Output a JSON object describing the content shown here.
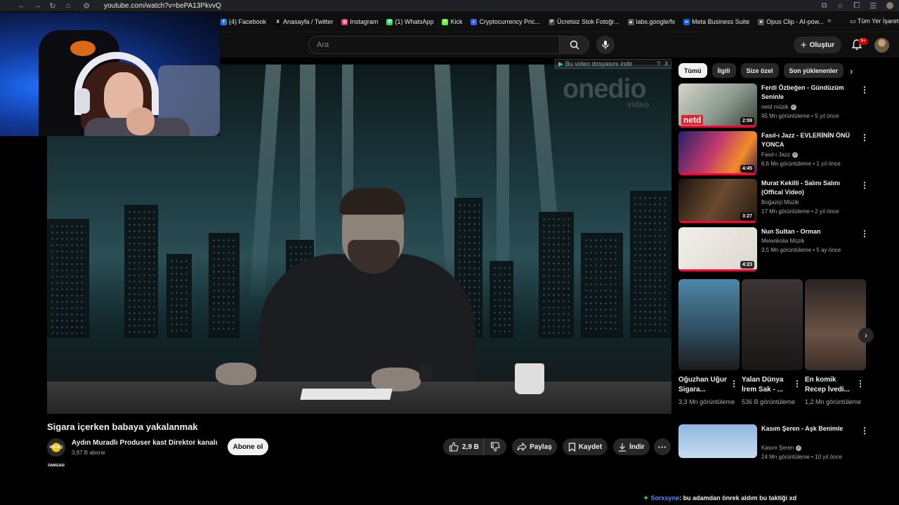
{
  "browser": {
    "url": "youtube.com/watch?v=bePA13PkvvQ",
    "bookmarks": [
      {
        "label": "(4) Facebook",
        "color": "#1877f2",
        "glyph": "f"
      },
      {
        "label": "Anasayfa / Twitter",
        "color": "#000000",
        "glyph": "X"
      },
      {
        "label": "Instagram",
        "color": "#e1306c",
        "glyph": "◎"
      },
      {
        "label": "(1) WhatsApp",
        "color": "#25d366",
        "glyph": "✆"
      },
      {
        "label": "Kick",
        "color": "#53fc18",
        "glyph": "K"
      },
      {
        "label": "Cryptocurrency Pric...",
        "color": "#3861fb",
        "glyph": "◐"
      },
      {
        "label": "Ücretsiz Stok Fotoğr...",
        "color": "#444444",
        "glyph": "P"
      },
      {
        "label": "labs.google/fx",
        "color": "#555555",
        "glyph": "▲"
      },
      {
        "label": "Meta Business Suite",
        "color": "#0668e1",
        "glyph": "∞"
      },
      {
        "label": "Opus Clip - AI-pow...",
        "color": "#555555",
        "glyph": "●"
      }
    ],
    "bookmarks_more": "»",
    "all_bookmarks": "Tüm Yer İşaretle"
  },
  "header": {
    "search_placeholder": "Ara",
    "create_label": "Oluştur",
    "notification_count": "9+"
  },
  "video": {
    "index_notice": "Bu video dosyasını indir",
    "index_notice_help": "?",
    "index_notice_close": "X",
    "watermark": "onedio",
    "watermark_sub": "video",
    "title": "Sigara içerken babaya yakalanmak",
    "channel_name": "Aydın Muradlı Produser kast Direktor kanalı",
    "channel_avatar_text": "MARAQ DAMGASI",
    "subscribers": "3,97 B abone",
    "subscribe_label": "Abone ol",
    "likes": "2,9 B",
    "share_label": "Paylaş",
    "save_label": "Kaydet",
    "download_label": "İndir",
    "more_label": "···"
  },
  "chips": [
    "Tümü",
    "İlgili",
    "Size özel",
    "Son yüklenenler"
  ],
  "recommendations": [
    {
      "title": "Ferdi Özbeğen - Gündüzüm Seninle",
      "channel": "netd müzik",
      "verified": true,
      "meta": "45 Mn görüntüleme • 5 yıl önce",
      "duration": "2:59",
      "thumb_bg": "linear-gradient(135deg,#d7d4c8,#8a9a8e 55%,#3a3f3a)",
      "thumb_badge": "netd"
    },
    {
      "title": "Fasıl-ı Jazz - EVLERİNİN ÖNÜ YONCA",
      "channel": "Fasıl-ı Jazz",
      "verified": true,
      "meta": "6,6 Mn görüntüleme • 1 yıl önce",
      "duration": "4:45",
      "thumb_bg": "linear-gradient(120deg,#2b1f6b,#c23b6b 45%,#f28c28 75%,#3a1a4a)",
      "thumb_badge": ""
    },
    {
      "title": "Murat Kekilli - Salını Salını (Offical Video)",
      "channel": "Boğaziçi Müzik",
      "verified": false,
      "meta": "17 Mn görüntüleme • 2 yıl önce",
      "duration": "3:27",
      "thumb_bg": "linear-gradient(120deg,#1b140f,#6b4a2f 50%,#241a12)",
      "thumb_badge": ""
    },
    {
      "title": "Nun Sultan  - Orman",
      "channel": "Melankolia Müzik",
      "verified": false,
      "meta": "3,5 Mn görüntüleme • 5 ay önce",
      "duration": "4:23",
      "thumb_bg": "linear-gradient(135deg,#f1efe9,#dcd8cf)",
      "thumb_badge": ""
    },
    {
      "title": "Kasım Şeren - Aşk Benimle",
      "channel": "Kasım Şeren",
      "verified": true,
      "meta": "24 Mn görüntüleme • 10 yıl önce",
      "duration": "",
      "thumb_bg": "linear-gradient(180deg,#8fb6e0,#c9dcef)",
      "thumb_badge": ""
    }
  ],
  "shorts": [
    {
      "title": "Oğuzhan Uğur Sigara...",
      "views": "3,3 Mn görüntüleme",
      "thumb_bg": "linear-gradient(180deg,#4d87a8,#2e4a5c 60%,#1b1b1b)"
    },
    {
      "title": "Yalan Dünya İrem Sak - ...",
      "views": "536 B görüntüleme",
      "thumb_bg": "linear-gradient(180deg,#3a3435,#1a1616)"
    },
    {
      "title": "En komik Recep İvedi...",
      "views": "1,2 Mn görüntüleme",
      "thumb_bg": "linear-gradient(180deg,#2a2420,#6a5246 60%,#3a2e28)"
    }
  ],
  "chat": {
    "user": "Sorxsyne",
    "message": ": bu adamdan önrek aldım bu taktiği xd"
  }
}
